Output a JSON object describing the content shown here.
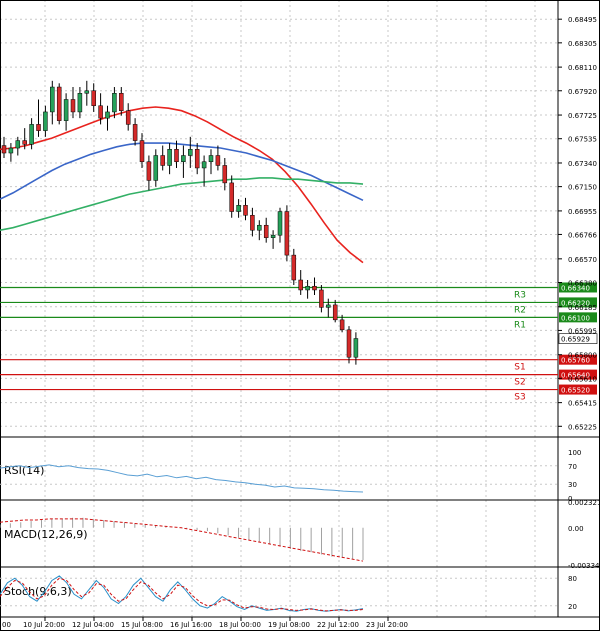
{
  "colors": {
    "background": "#ffffff",
    "grid": "#c8c8c8",
    "bull_candle": "#26a15a",
    "bear_candle": "#d42a2a",
    "candle_wick": "#000000",
    "ma_fast": "#e8231e",
    "ma_mid": "#3a66c8",
    "ma_slow": "#33b066",
    "resistance": "#1a8a1a",
    "support": "#d01010",
    "rsi_line": "#5a9fd4",
    "macd_hist": "#a0a0a0",
    "macd_signal": "#d01010",
    "stoch_main": "#2a8fc8",
    "stoch_signal": "#d01010"
  },
  "chart_data": [
    {
      "type": "candlestick",
      "name": "price",
      "y_ticks": [
        "0.68495",
        "0.68305",
        "0.68110",
        "0.67920",
        "0.67725",
        "0.67535",
        "0.67340",
        "0.67150",
        "0.66955",
        "0.66766",
        "0.66570",
        "0.66380",
        "0.66185",
        "0.65995",
        "0.65800",
        "0.65610",
        "0.65415",
        "0.65225"
      ],
      "ylim": [
        0.65147,
        0.68617
      ],
      "candles": [
        [
          0.6748,
          0.6755,
          0.6738,
          0.6742
        ],
        [
          0.6742,
          0.675,
          0.6735,
          0.6746
        ],
        [
          0.6746,
          0.6755,
          0.674,
          0.6752
        ],
        [
          0.6752,
          0.6762,
          0.6745,
          0.6749
        ],
        [
          0.6749,
          0.677,
          0.6745,
          0.6765
        ],
        [
          0.6765,
          0.6785,
          0.6755,
          0.676
        ],
        [
          0.676,
          0.678,
          0.6755,
          0.6775
        ],
        [
          0.6775,
          0.68,
          0.6765,
          0.6795
        ],
        [
          0.6795,
          0.6798,
          0.6765,
          0.6768
        ],
        [
          0.6768,
          0.679,
          0.676,
          0.6785
        ],
        [
          0.6785,
          0.6795,
          0.677,
          0.6775
        ],
        [
          0.6775,
          0.6795,
          0.677,
          0.679
        ],
        [
          0.679,
          0.68,
          0.678,
          0.6792
        ],
        [
          0.6792,
          0.6798,
          0.6775,
          0.678
        ],
        [
          0.678,
          0.679,
          0.6765,
          0.677
        ],
        [
          0.677,
          0.678,
          0.676,
          0.6775
        ],
        [
          0.6775,
          0.6795,
          0.677,
          0.679
        ],
        [
          0.679,
          0.6795,
          0.6772,
          0.6776
        ],
        [
          0.6776,
          0.6782,
          0.676,
          0.6765
        ],
        [
          0.6765,
          0.677,
          0.6748,
          0.6752
        ],
        [
          0.6752,
          0.6758,
          0.673,
          0.6735
        ],
        [
          0.6735,
          0.674,
          0.6712,
          0.672
        ],
        [
          0.672,
          0.6745,
          0.6715,
          0.674
        ],
        [
          0.674,
          0.6748,
          0.6728,
          0.6732
        ],
        [
          0.6732,
          0.675,
          0.6725,
          0.6745
        ],
        [
          0.6745,
          0.6752,
          0.673,
          0.6735
        ],
        [
          0.6735,
          0.6748,
          0.6722,
          0.674
        ],
        [
          0.674,
          0.6755,
          0.673,
          0.6745
        ],
        [
          0.6745,
          0.675,
          0.6725,
          0.673
        ],
        [
          0.673,
          0.674,
          0.6715,
          0.6735
        ],
        [
          0.6735,
          0.6745,
          0.6725,
          0.674
        ],
        [
          0.674,
          0.6748,
          0.6728,
          0.6732
        ],
        [
          0.6732,
          0.6738,
          0.6712,
          0.6718
        ],
        [
          0.6718,
          0.6724,
          0.669,
          0.6695
        ],
        [
          0.6695,
          0.6705,
          0.669,
          0.67
        ],
        [
          0.67,
          0.6706,
          0.6688,
          0.6692
        ],
        [
          0.6692,
          0.6698,
          0.6675,
          0.668
        ],
        [
          0.668,
          0.6688,
          0.6672,
          0.6684
        ],
        [
          0.6684,
          0.669,
          0.667,
          0.6674
        ],
        [
          0.6674,
          0.668,
          0.6665,
          0.6676
        ],
        [
          0.6676,
          0.6698,
          0.667,
          0.6695
        ],
        [
          0.6695,
          0.67,
          0.6655,
          0.666
        ],
        [
          0.666,
          0.6665,
          0.6636,
          0.664
        ],
        [
          0.664,
          0.6648,
          0.6628,
          0.6632
        ],
        [
          0.6632,
          0.664,
          0.6625,
          0.6635
        ],
        [
          0.6635,
          0.6642,
          0.6628,
          0.6632
        ],
        [
          0.6632,
          0.6636,
          0.6614,
          0.6618
        ],
        [
          0.6618,
          0.6625,
          0.661,
          0.662
        ],
        [
          0.662,
          0.6624,
          0.6606,
          0.6608
        ],
        [
          0.6608,
          0.6612,
          0.6598,
          0.66
        ],
        [
          0.66,
          0.6603,
          0.6573,
          0.6578
        ],
        [
          0.6578,
          0.6598,
          0.6572,
          0.6593
        ]
      ],
      "ma_fast": [
        0.6745,
        0.6746,
        0.6748,
        0.6751,
        0.6754,
        0.6758,
        0.6762,
        0.6766,
        0.677,
        0.6773,
        0.6776,
        0.6778,
        0.6779,
        0.6778,
        0.6776,
        0.6772,
        0.6767,
        0.6761,
        0.6755,
        0.675,
        0.6744,
        0.6737,
        0.6727,
        0.6715,
        0.6701,
        0.6686,
        0.6672,
        0.6662,
        0.6654
      ],
      "ma_mid": [
        0.6705,
        0.671,
        0.6716,
        0.6722,
        0.6728,
        0.6733,
        0.6737,
        0.6741,
        0.6744,
        0.6747,
        0.6749,
        0.675,
        0.675,
        0.675,
        0.6749,
        0.6748,
        0.6747,
        0.6746,
        0.6744,
        0.6742,
        0.6739,
        0.6736,
        0.6732,
        0.6728,
        0.6724,
        0.6719,
        0.6714,
        0.6709,
        0.6704
      ],
      "ma_slow": [
        0.668,
        0.6682,
        0.6685,
        0.6688,
        0.6691,
        0.6694,
        0.6697,
        0.67,
        0.6703,
        0.6706,
        0.6709,
        0.6711,
        0.6713,
        0.6715,
        0.6717,
        0.6718,
        0.6719,
        0.672,
        0.6721,
        0.6721,
        0.6722,
        0.6722,
        0.6721,
        0.6721,
        0.672,
        0.6719,
        0.6718,
        0.6718,
        0.6717
      ],
      "levels": [
        {
          "label": "R3",
          "value": 0.6634,
          "price_label": "0.66340",
          "kind": "resistance"
        },
        {
          "label": "R2",
          "value": 0.6622,
          "price_label": "0.66220",
          "kind": "resistance"
        },
        {
          "label": "R1",
          "value": 0.661,
          "price_label": "0.66100",
          "kind": "resistance"
        },
        {
          "label": "S1",
          "value": 0.6576,
          "price_label": "0.65760",
          "kind": "support"
        },
        {
          "label": "S2",
          "value": 0.6564,
          "price_label": "0.65640",
          "kind": "support"
        },
        {
          "label": "S3",
          "value": 0.6552,
          "price_label": "0.65520",
          "kind": "support"
        }
      ],
      "current_price": 0.65929,
      "current_price_label": "0.65929"
    },
    {
      "type": "line",
      "name": "rsi",
      "title": "RSI(14)",
      "y_ticks": [
        "100",
        "70",
        "30",
        "0"
      ],
      "ylim": [
        0,
        100
      ],
      "values": [
        65,
        68,
        70,
        66,
        69,
        72,
        68,
        70,
        66,
        64,
        63,
        60,
        55,
        50,
        48,
        52,
        46,
        49,
        44,
        47,
        42,
        45,
        40,
        38,
        35,
        33,
        30,
        28,
        24,
        26,
        22,
        21,
        20,
        18,
        17,
        15,
        14,
        13
      ]
    },
    {
      "type": "bar+line",
      "name": "macd",
      "title": "MACD(12,26,9)",
      "y_ticks": [
        "0.002321",
        "0.00",
        "-0.003348"
      ],
      "ylim": [
        -0.00335,
        0.00232
      ],
      "histogram": [
        0.0003,
        0.0004,
        0.0005,
        0.0006,
        0.0007,
        0.0008,
        0.0008,
        0.0009,
        0.0009,
        0.0008,
        0.0007,
        0.0006,
        0.0005,
        0.0004,
        0.0003,
        0.0002,
        0.0001,
        0.0,
        -0.0001,
        -0.0002,
        -0.0003,
        -0.0005,
        -0.0007,
        -0.0009,
        -0.0011,
        -0.0013,
        -0.0015,
        -0.0017,
        -0.0019,
        -0.0021,
        -0.0022,
        -0.0024,
        -0.0026,
        -0.0027,
        -0.0028,
        -0.0029
      ],
      "signal": [
        0.0005,
        0.0006,
        0.0007,
        0.0007,
        0.0008,
        0.0008,
        0.0008,
        0.0008,
        0.0007,
        0.0006,
        0.0005,
        0.0004,
        0.0003,
        0.0002,
        0.0001,
        0.0,
        -0.0002,
        -0.0004,
        -0.0006,
        -0.0008,
        -0.001,
        -0.0012,
        -0.0014,
        -0.0016,
        -0.0018,
        -0.002,
        -0.0022,
        -0.0024,
        -0.0026,
        -0.0028,
        -0.003
      ]
    },
    {
      "type": "line",
      "name": "stochastic",
      "title": "Stoch(9,6,3)",
      "y_ticks": [
        "80",
        "20"
      ],
      "ylim": [
        0,
        100
      ],
      "main": [
        45,
        70,
        80,
        65,
        40,
        30,
        50,
        75,
        85,
        70,
        45,
        35,
        55,
        75,
        60,
        35,
        25,
        40,
        65,
        80,
        60,
        40,
        30,
        55,
        72,
        55,
        35,
        20,
        15,
        25,
        40,
        30,
        18,
        12,
        20,
        15,
        10,
        12,
        15,
        10,
        8,
        12,
        14,
        10,
        8,
        10,
        12,
        9,
        11,
        14
      ],
      "signal": [
        40,
        60,
        75,
        70,
        50,
        35,
        42,
        65,
        80,
        75,
        55,
        40,
        48,
        68,
        65,
        45,
        30,
        35,
        55,
        72,
        65,
        48,
        35,
        45,
        65,
        60,
        42,
        28,
        20,
        22,
        33,
        32,
        22,
        15,
        18,
        17,
        13,
        12,
        14,
        12,
        10,
        11,
        13,
        11,
        9,
        10,
        11,
        10,
        10,
        12
      ]
    }
  ],
  "x_axis_labels": [
    "00",
    "10 Jul 20:00",
    "12 Jul 04:00",
    "15 Jul 08:00",
    "16 Jul 16:00",
    "18 Jul 00:00",
    "19 Jul 08:00",
    "22 Jul 12:00",
    "23 Jul 20:00"
  ]
}
